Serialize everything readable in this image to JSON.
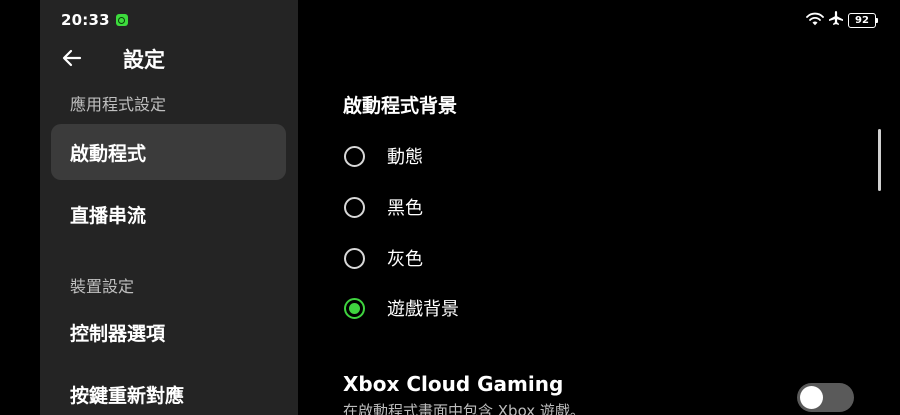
{
  "status_bar": {
    "time": "20:33",
    "battery": "92",
    "icons": [
      "app-notification-icon",
      "wifi-icon",
      "airplane-mode-icon",
      "battery-icon"
    ]
  },
  "header": {
    "title": "設定",
    "back_icon": "arrow-left-icon"
  },
  "sidebar": {
    "sections": [
      {
        "header": "應用程式設定",
        "items": [
          {
            "label": "啟動程式",
            "selected": true
          },
          {
            "label": "直播串流",
            "selected": false
          }
        ]
      },
      {
        "header": "裝置設定",
        "items": [
          {
            "label": "控制器選項",
            "selected": false
          },
          {
            "label": "按鍵重新對應",
            "selected": false
          }
        ]
      }
    ]
  },
  "main": {
    "heading": "啟動程式背景",
    "options": [
      {
        "label": "動態",
        "checked": false
      },
      {
        "label": "黑色",
        "checked": false
      },
      {
        "label": "灰色",
        "checked": false
      },
      {
        "label": "遊戲背景",
        "checked": true
      }
    ],
    "xbox_setting": {
      "title": "Xbox Cloud Gaming",
      "description": "在啟動程式畫面中包含 Xbox 遊戲。",
      "enabled": false
    }
  },
  "colors": {
    "background": "#000000",
    "sidebar": "#242424",
    "selected_item": "#3b3b3b",
    "accent_green": "#3fd43f",
    "toggle_off": "#5a5a5a"
  }
}
